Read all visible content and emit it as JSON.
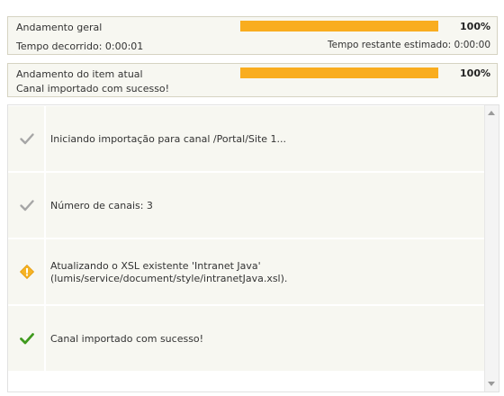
{
  "overall": {
    "label": "Andamento geral",
    "percent_text": "100%",
    "progress": 1.0,
    "elapsed": "Tempo decorrido: 0:00:01",
    "remaining": "Tempo restante estimado: 0:00:00"
  },
  "current": {
    "label": "Andamento do item atual",
    "percent_text": "100%",
    "progress": 1.0,
    "status": "Canal importado com sucesso!"
  },
  "log": {
    "entries": [
      {
        "icon": "check-gray-icon",
        "line1": "Iniciando importação para canal /Portal/Site 1...",
        "line2": ""
      },
      {
        "icon": "check-gray-icon",
        "line1": "Número de canais: 3",
        "line2": ""
      },
      {
        "icon": "warning-icon",
        "line1": "Atualizando o XSL existente 'Intranet Java'",
        "line2": "(lumis/service/document/style/intranetJava.xsl)."
      },
      {
        "icon": "check-green-icon",
        "line1": "Canal importado com sucesso!",
        "line2": ""
      }
    ]
  },
  "colors": {
    "progress_fill": "#f9ad1f",
    "check_gray": "#a6a6a6",
    "check_green": "#3f9a1e",
    "warning": "#f5b324"
  }
}
